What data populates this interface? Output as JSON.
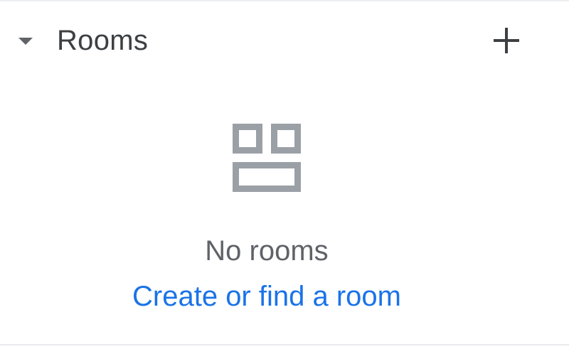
{
  "rooms_section": {
    "title": "Rooms",
    "collapse_icon": "caret-down-icon",
    "add_icon": "plus-icon"
  },
  "empty_state": {
    "icon": "rooms-grid-icon",
    "message": "No rooms",
    "link_label": "Create or find a room"
  },
  "colors": {
    "title": "#3c4043",
    "icon": "#9aa0a6",
    "message": "#5f6368",
    "link": "#1a73e8",
    "divider": "#e8eaed"
  }
}
